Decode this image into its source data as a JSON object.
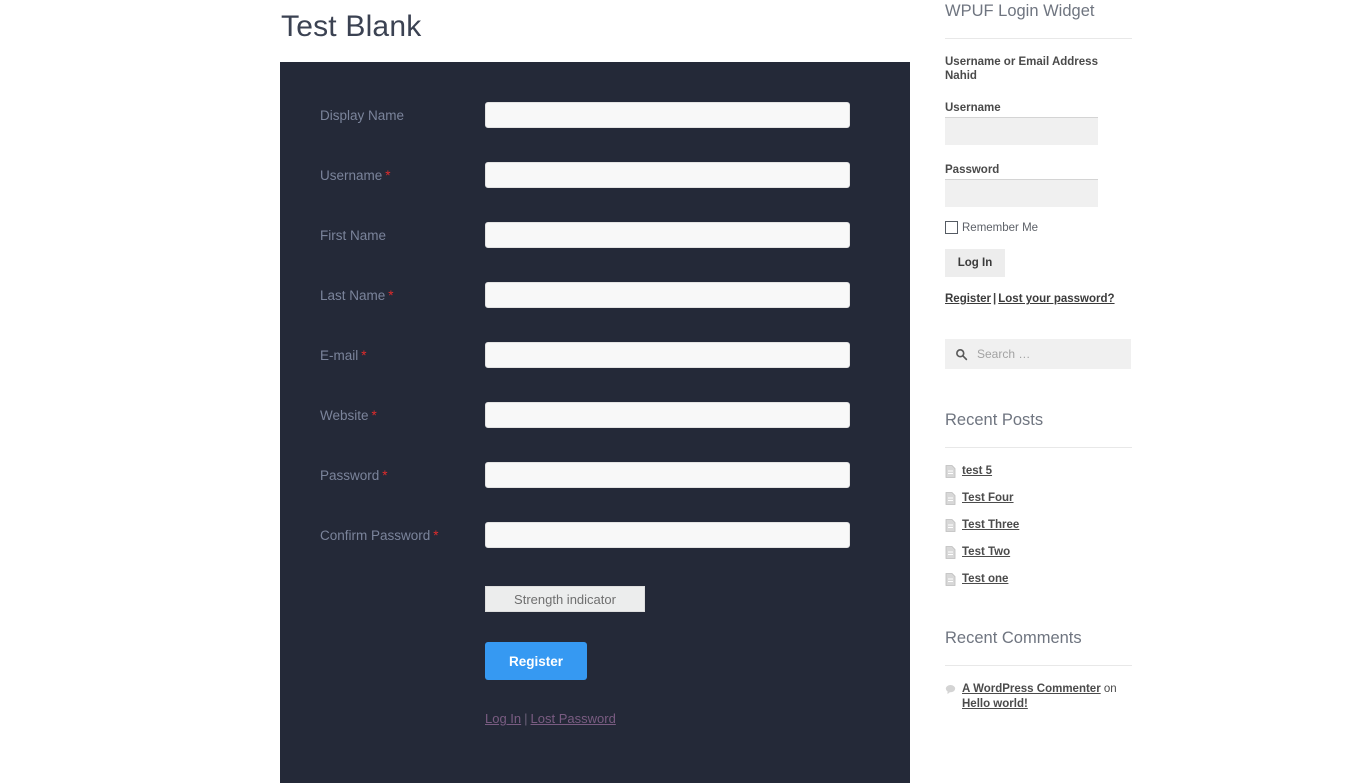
{
  "page": {
    "title": "Test Blank"
  },
  "registration_form": {
    "fields": [
      {
        "label": "Display Name",
        "required": false,
        "value": ""
      },
      {
        "label": "Username",
        "required": true,
        "value": ""
      },
      {
        "label": "First Name",
        "required": false,
        "value": ""
      },
      {
        "label": "Last Name",
        "required": true,
        "value": ""
      },
      {
        "label": "E-mail",
        "required": true,
        "value": ""
      },
      {
        "label": "Website",
        "required": true,
        "value": ""
      },
      {
        "label": "Password",
        "required": true,
        "value": ""
      },
      {
        "label": "Confirm Password",
        "required": true,
        "value": ""
      }
    ],
    "required_marker": "*",
    "strength_indicator": "Strength indicator",
    "submit_label": "Register",
    "footer_links": {
      "login": "Log In",
      "separator": "|",
      "lost_password": "Lost Password"
    },
    "colors": {
      "panel_background": "#242938",
      "label": "#7b849b",
      "required": "#e02b2b",
      "submit_button": "#3699f2",
      "footer_link": "#7a5c82"
    }
  },
  "sidebar": {
    "login_widget": {
      "title": "WPUF Login Widget",
      "intro": "Username or Email Address Nahid",
      "username_label": "Username",
      "username_value": "",
      "password_label": "Password",
      "password_value": "",
      "remember_label": "Remember Me",
      "remember_checked": false,
      "submit_label": "Log In",
      "links": {
        "register": "Register",
        "separator": "|",
        "lost_password": "Lost your password?"
      }
    },
    "search": {
      "placeholder": "Search …",
      "value": "",
      "icon": "search-icon"
    },
    "recent_posts": {
      "title": "Recent Posts",
      "items": [
        {
          "label": "test 5",
          "icon": "document-icon"
        },
        {
          "label": "Test Four",
          "icon": "document-icon"
        },
        {
          "label": "Test Three",
          "icon": "document-icon"
        },
        {
          "label": "Test Two",
          "icon": "document-icon"
        },
        {
          "label": "Test one",
          "icon": "document-icon"
        }
      ]
    },
    "recent_comments": {
      "title": "Recent Comments",
      "items": [
        {
          "icon": "comment-icon",
          "author": "A WordPress Commenter",
          "connector": "on",
          "post": "Hello world!"
        }
      ]
    }
  }
}
